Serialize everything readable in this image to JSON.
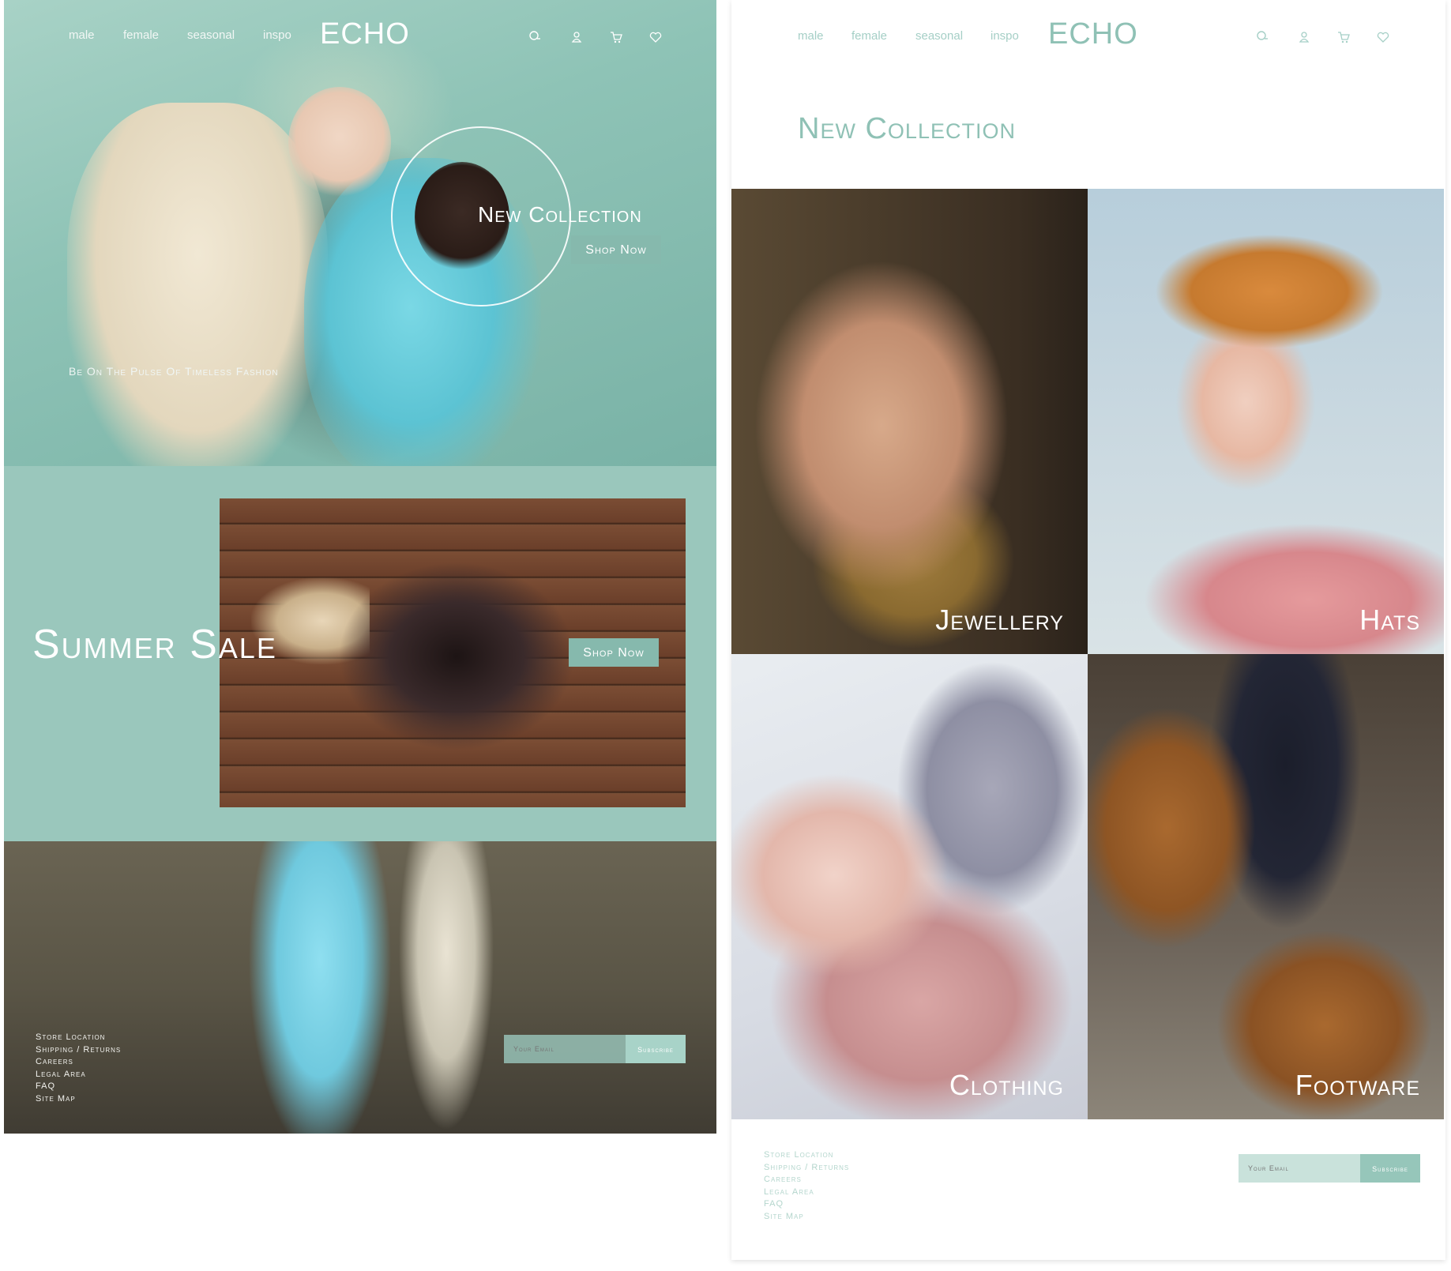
{
  "brand": "ECHO",
  "nav": [
    "male",
    "female",
    "seasonal",
    "inspo"
  ],
  "icons": [
    "search-icon",
    "user-icon",
    "cart-icon",
    "heart-icon"
  ],
  "colors": {
    "accent": "#8fc1b5",
    "button": "#86b9ad",
    "sale_bg": "#9ac7bc"
  },
  "left": {
    "hero": {
      "title": "New Collection",
      "button": "Shop Now",
      "tagline": "Be On The Pulse Of Timeless Fashion"
    },
    "sale": {
      "title": "Summer Sale",
      "button": "Shop Now"
    }
  },
  "right": {
    "heading": "New Collection",
    "categories": [
      "Jewellery",
      "Hats",
      "Clothing",
      "Footware"
    ]
  },
  "footer": {
    "links": [
      "Store Location",
      "Shipping / Returns",
      "Careers",
      "Legal Area",
      "FAQ",
      "Site Map"
    ],
    "email_placeholder": "Your Email",
    "subscribe": "Subscribe"
  }
}
